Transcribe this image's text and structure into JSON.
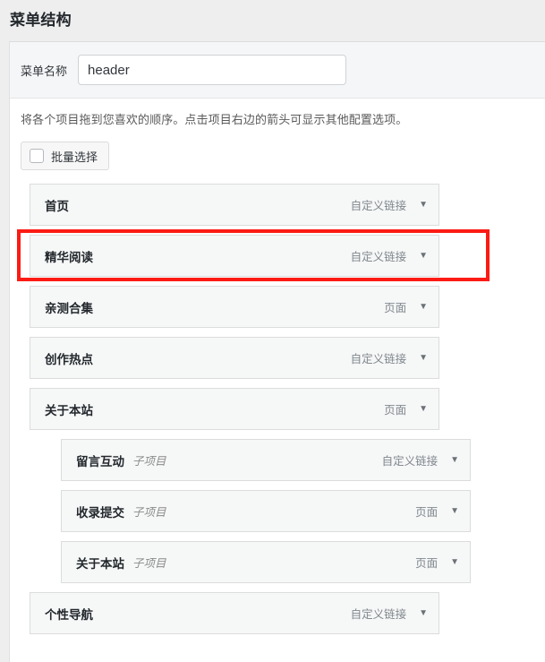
{
  "page": {
    "title": "菜单结构"
  },
  "menu_name": {
    "label": "菜单名称",
    "value": "header",
    "placeholder": ""
  },
  "hint": "将各个项目拖到您喜欢的顺序。点击项目右边的箭头可显示其他配置选项。",
  "bulk_select": {
    "label": "批量选择",
    "checked": false,
    "checkbox_icon": "checkbox-empty-icon"
  },
  "sub_item_flag": "子项目",
  "arrow_icon": "chevron-down-icon",
  "menu_items": [
    {
      "title": "首页",
      "type": "自定义链接",
      "depth": 0,
      "sub_flag": "",
      "highlighted": false
    },
    {
      "title": "精华阅读",
      "type": "自定义链接",
      "depth": 0,
      "sub_flag": "",
      "highlighted": true
    },
    {
      "title": "亲测合集",
      "type": "页面",
      "depth": 0,
      "sub_flag": "",
      "highlighted": false
    },
    {
      "title": "创作热点",
      "type": "自定义链接",
      "depth": 0,
      "sub_flag": "",
      "highlighted": false
    },
    {
      "title": "关于本站",
      "type": "页面",
      "depth": 0,
      "sub_flag": "",
      "highlighted": false
    },
    {
      "title": "留言互动",
      "type": "自定义链接",
      "depth": 1,
      "sub_flag": "子项目",
      "highlighted": false
    },
    {
      "title": "收录提交",
      "type": "页面",
      "depth": 1,
      "sub_flag": "子项目",
      "highlighted": false
    },
    {
      "title": "关于本站",
      "type": "页面",
      "depth": 1,
      "sub_flag": "子项目",
      "highlighted": false
    },
    {
      "title": "个性导航",
      "type": "自定义链接",
      "depth": 0,
      "sub_flag": "",
      "highlighted": false
    }
  ],
  "colors": {
    "highlight": "#fc1b14",
    "page_background": "#eeeeee",
    "panel_background": "#ffffff",
    "item_background": "#f6f7f7"
  }
}
